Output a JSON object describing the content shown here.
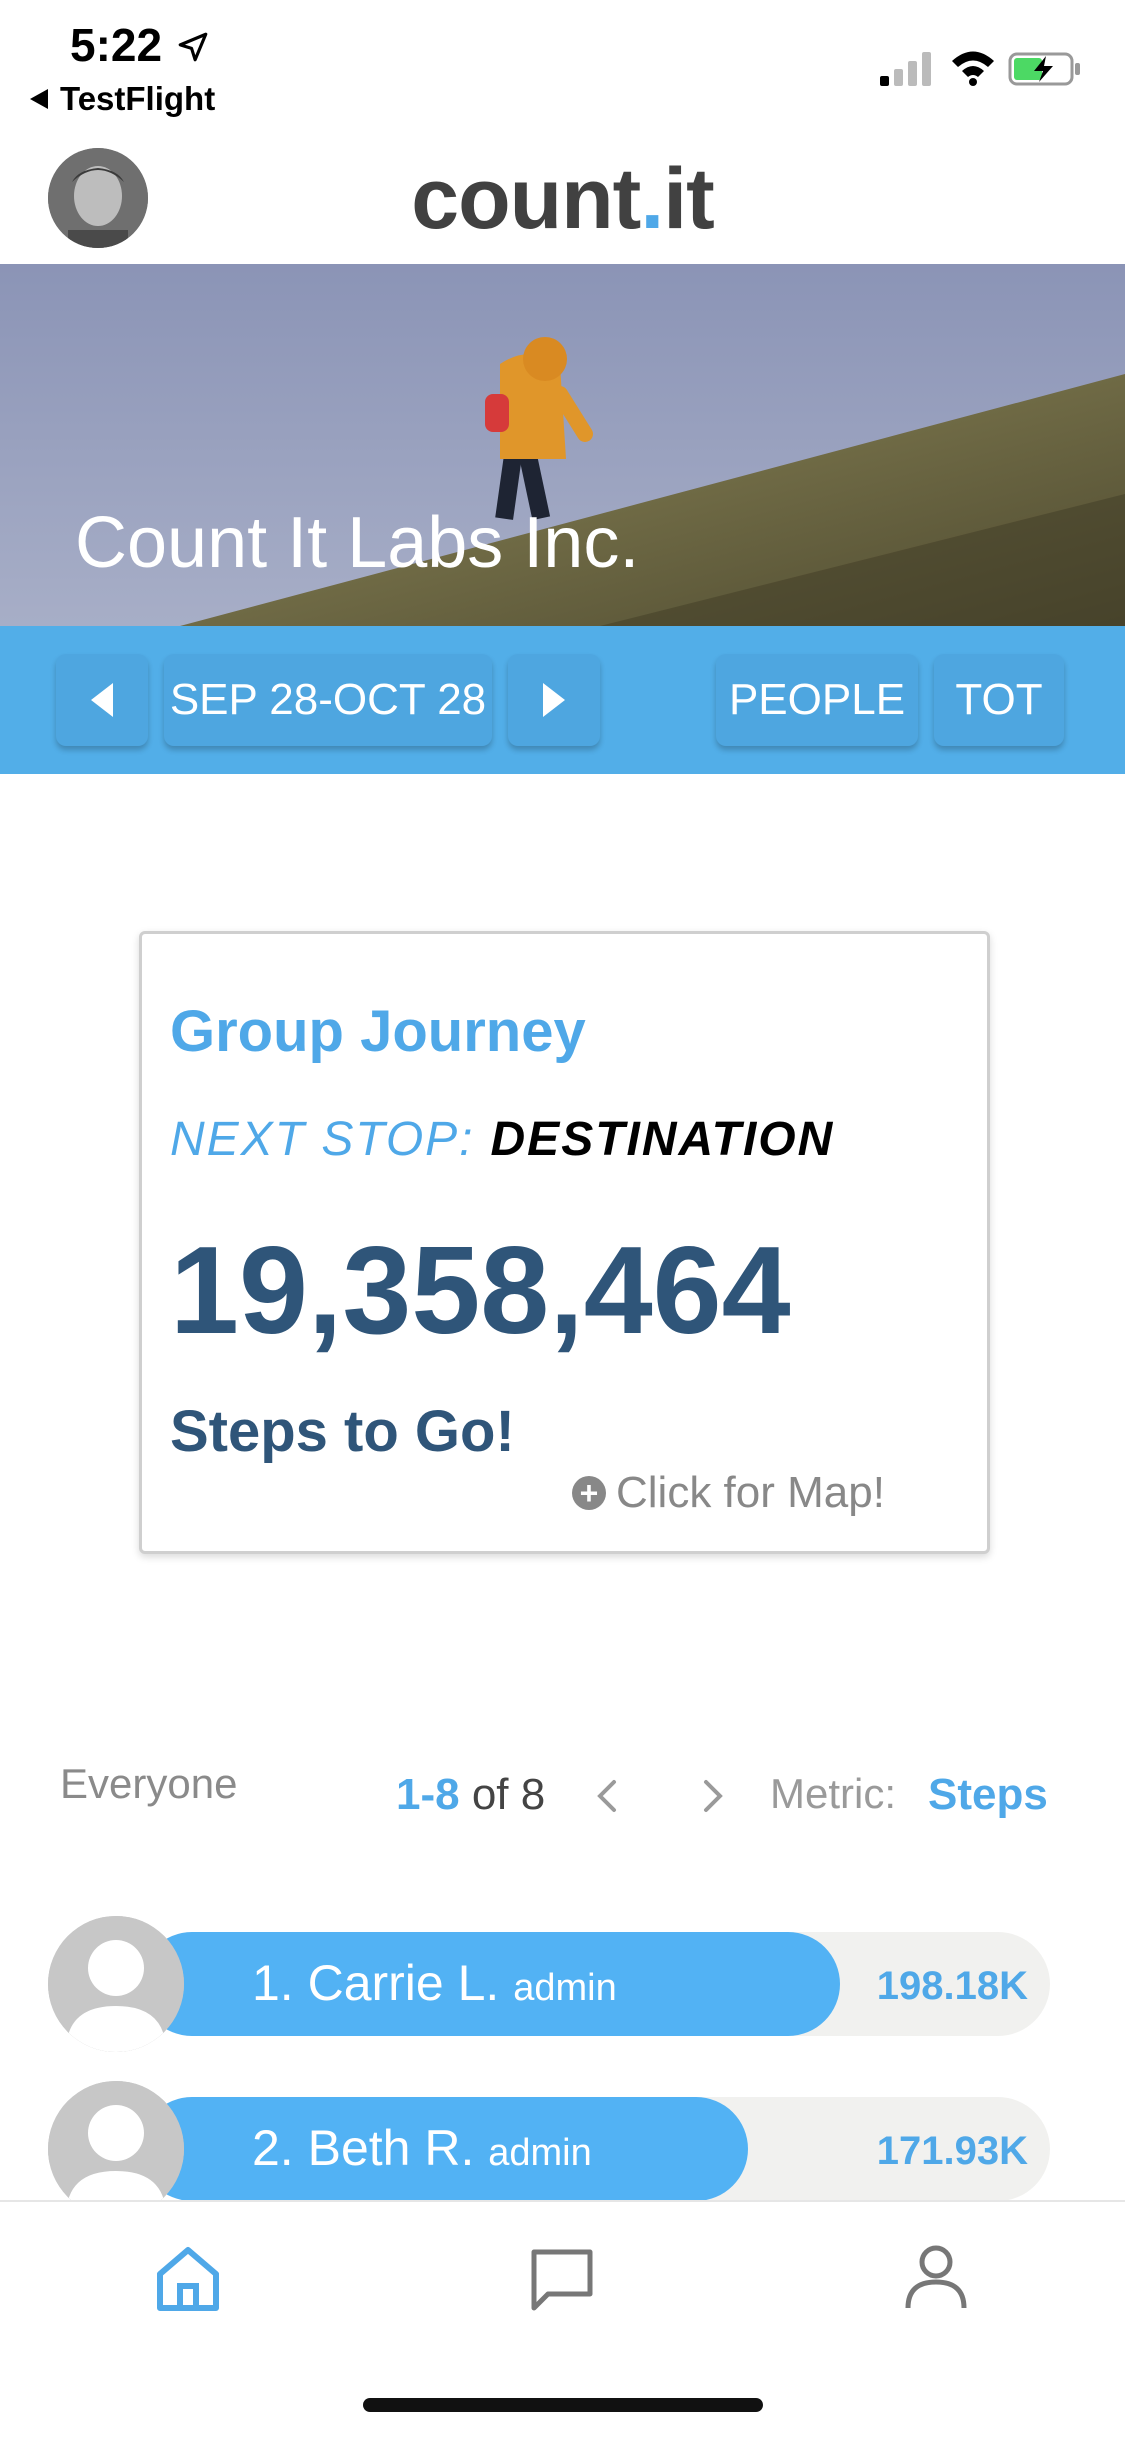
{
  "status": {
    "time": "5:22",
    "back_app": "TestFlight"
  },
  "header": {
    "logo_main": "count",
    "logo_dot": ".",
    "logo_end": "it"
  },
  "hero": {
    "title": "Count It Labs Inc."
  },
  "nav": {
    "date_range": "SEP 28-OCT 28",
    "people_label": "PEOPLE",
    "tot_label": "TOT"
  },
  "card": {
    "title": "Group Journey",
    "next_stop_label": "NEXT STOP:",
    "destination": "DESTINATION",
    "steps_remaining": "19,358,464",
    "steps_caption": "Steps to Go!",
    "map_link": "Click for Map!"
  },
  "leaderboard": {
    "filter": "Everyone",
    "range_highlight": "1-8",
    "range_of": "of 8",
    "metric_label": "Metric:",
    "metric_value": "Steps",
    "rows": [
      {
        "name": "1. Carrie L.",
        "role": "admin",
        "value": "198.18K",
        "fill": 1.0
      },
      {
        "name": "2. Beth R.",
        "role": "admin",
        "value": "171.93K",
        "fill": 0.868
      }
    ]
  },
  "tabs": {
    "home": "home-icon",
    "messages": "chat-icon",
    "profile": "person-icon"
  },
  "colors": {
    "accent": "#4fa8e8",
    "bar": "#52b2f4",
    "dark_blue": "#2f5579"
  }
}
